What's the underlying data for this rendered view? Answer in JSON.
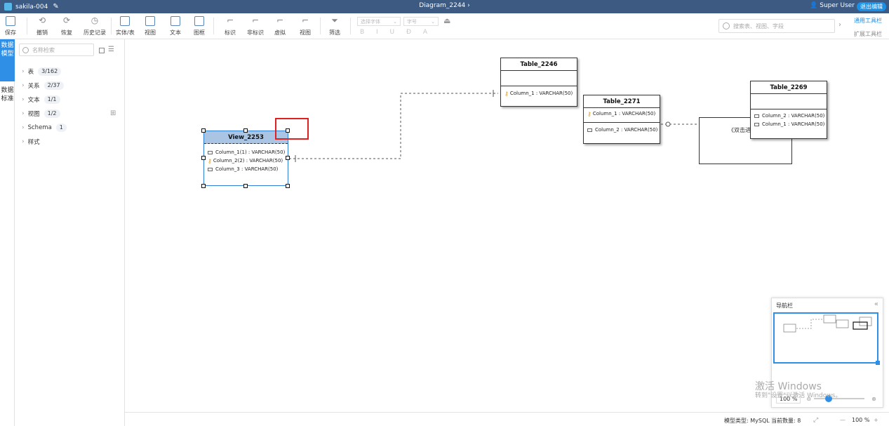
{
  "titlebar": {
    "project": "sakila-004",
    "diagram": "Diagram_2244",
    "user": "Super User",
    "exit_label": "退出编辑"
  },
  "toolbar": {
    "save": "保存",
    "undo": "撤销",
    "redo": "恢复",
    "history": "历史记录",
    "entity": "实体/表",
    "view": "视图",
    "text": "文本",
    "frame": "图框",
    "identifying": "标识",
    "non_identifying": "非标识",
    "virtual": "虚拟",
    "view_rel": "视图",
    "filter": "筛选",
    "font_select": "选择字体",
    "font_size": "字号",
    "format_buttons": "B I U Đ A",
    "search_placeholder": "搜索表、视图、字段",
    "general_toolbar": "通用工具栏",
    "extended_toolbar": "扩展工具栏"
  },
  "sidebar_tabs": [
    {
      "label": "数据模型",
      "active": true
    },
    {
      "label": "数据标准",
      "active": false
    }
  ],
  "panel": {
    "search_placeholder": "名称检索",
    "tree": [
      {
        "label": "表",
        "count": "3/162"
      },
      {
        "label": "关系",
        "count": "2/37"
      },
      {
        "label": "文本",
        "count": "1/1"
      },
      {
        "label": "视图",
        "count": "1/2"
      },
      {
        "label": "Schema",
        "count": "1"
      },
      {
        "label": "样式",
        "count": ""
      }
    ]
  },
  "entities": {
    "table_2246": {
      "title": "Table_2246",
      "columns": [
        {
          "text": "Column_1 : VARCHAR(50)",
          "icon": "key-icon"
        }
      ]
    },
    "table_2271": {
      "title": "Table_2271",
      "pk": [
        {
          "text": "Column_1 : VARCHAR(50)",
          "icon": "key-icon"
        }
      ],
      "columns": [
        {
          "text": "Column_2 : VARCHAR(50)",
          "icon": "column-icon"
        }
      ]
    },
    "table_2269": {
      "title": "Table_2269",
      "columns": [
        {
          "text": "Column_2 : VARCHAR(50)",
          "icon": "column-icon"
        },
        {
          "text": "Column_1 : VARCHAR(50)",
          "icon": "column-icon"
        }
      ]
    },
    "view_2253": {
      "title": "View_2253",
      "columns": [
        {
          "text": "Column_1(1) : VARCHAR(50)",
          "icon": "column-icon"
        },
        {
          "text": "Column_2(2) : VARCHAR(50)",
          "icon": "key-icon"
        },
        {
          "text": "Column_3 : VARCHAR(50)",
          "icon": "column-icon"
        }
      ]
    }
  },
  "note": {
    "text": "《双击进行"
  },
  "navigator": {
    "title": "导航栏",
    "zoom": "100 %"
  },
  "watermark": {
    "line1": "激活 Windows",
    "line2": "转到\"设置\"以激活 Windows。"
  },
  "statusbar": {
    "model_type": "模型类型: MySQL",
    "count": "当前数量: 8",
    "zoom": "100 %"
  },
  "colors": {
    "titlebar": "#3c5a82",
    "accent": "#2f8ee6",
    "view_header": "#aac4e4",
    "selection_box": "#e02020"
  }
}
